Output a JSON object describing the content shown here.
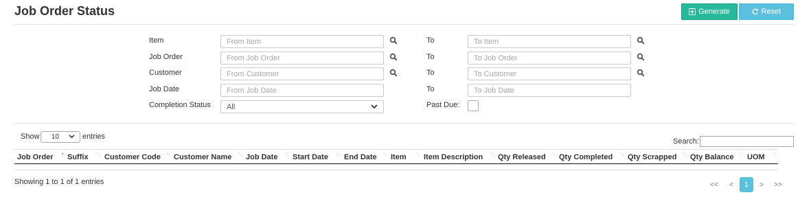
{
  "page": {
    "title": "Job Order Status"
  },
  "actions": {
    "generate_label": "Generate",
    "reset_label": "Reset"
  },
  "filters": {
    "item": {
      "label": "Item",
      "from_placeholder": "From Item",
      "to_label": "To",
      "to_placeholder": "To Item"
    },
    "job_order": {
      "label": "Job Order",
      "from_placeholder": "From Job Order",
      "to_label": "To",
      "to_placeholder": "To Job Order"
    },
    "customer": {
      "label": "Customer",
      "from_placeholder": "From Customer",
      "to_label": "To",
      "to_placeholder": "To Customer"
    },
    "job_date": {
      "label": "Job Date",
      "from_placeholder": "From Job Date",
      "to_label": "To",
      "to_placeholder": "To Job Date"
    },
    "completion_status": {
      "label": "Completion Status",
      "selected": "All"
    },
    "past_due": {
      "label": "Past Due:",
      "checked": false
    }
  },
  "table_controls": {
    "show_label": "Show",
    "page_length": "10",
    "entries_label": "entries",
    "search_label": "Search:"
  },
  "table": {
    "columns": [
      "Job Order",
      "Suffix",
      "Customer Code",
      "Customer Name",
      "Job Date",
      "Start Date",
      "End Date",
      "Item",
      "Item Description",
      "Qty Released",
      "Qty Completed",
      "Qty Scrapped",
      "Qty Balance",
      "UOM"
    ],
    "rows": []
  },
  "pagination": {
    "info": "Showing 1 to 1 of 1 entries",
    "first": "<<",
    "prev": "<",
    "current": "1",
    "next": ">",
    "last": ">>"
  },
  "colors": {
    "generate": "#26b99a",
    "reset": "#5bc0de",
    "active_page": "#5bc0de"
  },
  "icons": {
    "generate": "plus-square-icon",
    "reset": "refresh-icon",
    "lookup": "search-icon",
    "select": "chevron-down-icon"
  }
}
